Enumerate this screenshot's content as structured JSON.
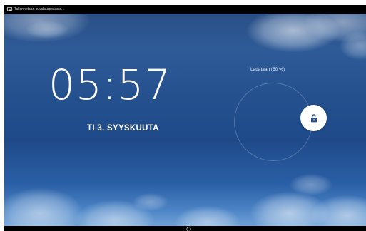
{
  "status_bar": {
    "notification_text": "Tallennetaan kuvakaappausta...",
    "notification_icon": "image-icon"
  },
  "lock_screen": {
    "time": "05:57",
    "date": "TI 3. SYYSKUUTA",
    "charging_status": "Ladataan (60 %)",
    "unlock_icon": "unlocked-padlock-icon"
  },
  "nav_bar": {
    "home_icon": "home-circle-icon"
  },
  "colors": {
    "sky_top": "#2a4f86",
    "sky_bottom": "#6fa2d6",
    "text": "#ffffff"
  }
}
